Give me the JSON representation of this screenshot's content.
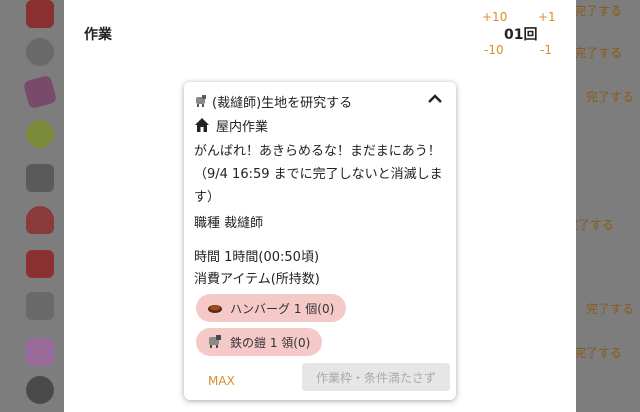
{
  "page": {
    "title": "作業",
    "counter": "01回",
    "steps": {
      "plus10": "+10",
      "plus1": "+1",
      "minus10": "-10",
      "minus1": "-1"
    }
  },
  "background": {
    "left_items_paren": "(",
    "right_texts": [
      "完了する",
      "完了する",
      "完了する",
      "完了する",
      "完了する",
      "完了する"
    ]
  },
  "card": {
    "header_icon": "tailor-goat-icon",
    "header_title": "(裁縫師)生地を研究する",
    "sub_icon": "house-icon",
    "sub_title": "屋内作業",
    "message": "がんばれ！あきらめるな！まだまにあう！（9/4 16:59 までに完了しないと消滅します）",
    "job": "職種 裁縫師",
    "time": "時間 1時間(00:50頃)",
    "consume_label": "消費アイテム(所持数)",
    "items": [
      {
        "icon": "hamburger-icon",
        "label": "ハンバーグ 1 個(0)"
      },
      {
        "icon": "armor-goat-icon",
        "label": "鉄の鎧 1 領(0)"
      }
    ],
    "max_label": "MAX",
    "action_label": "作業枠・条件満たさず"
  },
  "colors": {
    "accent": "#d8902a",
    "chip_bg": "#f6c9c9",
    "disabled_btn": "#e6e6e6"
  }
}
